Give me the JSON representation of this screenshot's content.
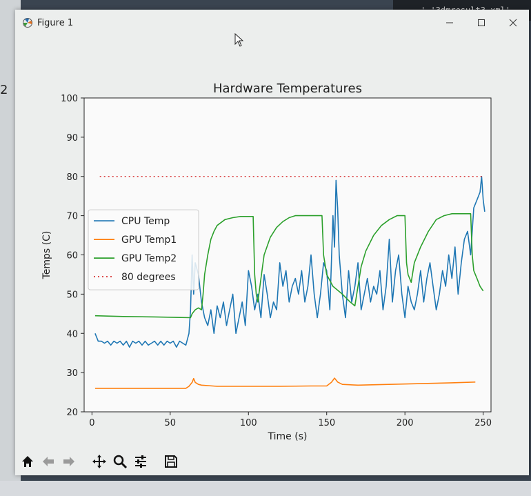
{
  "window": {
    "title": "Figure 1"
  },
  "background": {
    "left_text": "2",
    "code_snippet": "' '3dmresult3.xml'"
  },
  "toolbar": {
    "buttons": [
      "home-icon",
      "back-icon",
      "forward-icon",
      "pan-icon",
      "zoom-icon",
      "configure-icon",
      "save-icon"
    ]
  },
  "chart_data": {
    "type": "line",
    "title": "Hardware Temperatures",
    "xlabel": "Time (s)",
    "ylabel": "Temps (C)",
    "xlim": [
      -5,
      255
    ],
    "ylim": [
      20,
      100
    ],
    "xticks": [
      0,
      50,
      100,
      150,
      200,
      250
    ],
    "yticks": [
      20,
      30,
      40,
      50,
      60,
      70,
      80,
      90,
      100
    ],
    "grid": false,
    "legend_position": "center-left",
    "series": [
      {
        "name": "CPU Temp",
        "color": "#1f77b4",
        "x": [
          2,
          4,
          6,
          8,
          10,
          12,
          14,
          16,
          18,
          20,
          22,
          24,
          26,
          28,
          30,
          32,
          34,
          36,
          38,
          40,
          42,
          44,
          46,
          48,
          50,
          52,
          54,
          56,
          58,
          60,
          62,
          63,
          64,
          65,
          66,
          68,
          70,
          72,
          74,
          76,
          78,
          80,
          82,
          84,
          86,
          88,
          90,
          92,
          94,
          96,
          98,
          100,
          102,
          104,
          106,
          108,
          110,
          112,
          114,
          116,
          118,
          120,
          122,
          124,
          126,
          128,
          130,
          132,
          134,
          136,
          138,
          140,
          142,
          144,
          146,
          148,
          150,
          152,
          154,
          155,
          156,
          157,
          158,
          160,
          162,
          164,
          166,
          168,
          170,
          172,
          174,
          176,
          178,
          180,
          182,
          184,
          186,
          188,
          190,
          192,
          194,
          196,
          198,
          200,
          202,
          204,
          206,
          208,
          210,
          212,
          214,
          216,
          218,
          220,
          222,
          224,
          226,
          228,
          230,
          232,
          234,
          236,
          238,
          240,
          242,
          244,
          246,
          248,
          249,
          250,
          251
        ],
        "y": [
          40,
          38,
          38,
          37.5,
          38,
          37,
          38,
          37.5,
          38,
          37,
          38,
          36.5,
          38,
          37.5,
          38,
          37,
          38,
          37,
          37.5,
          38,
          37,
          38,
          37,
          38,
          37.5,
          38,
          36.5,
          38,
          37.5,
          37,
          40,
          46,
          60,
          50,
          58,
          55,
          48,
          44,
          42,
          46,
          40,
          47,
          44,
          48,
          42,
          46,
          50,
          40,
          44,
          48,
          42,
          56,
          52,
          46,
          50,
          44,
          55,
          50,
          44,
          48,
          46,
          58,
          52,
          56,
          48,
          52,
          54,
          50,
          56,
          48,
          52,
          60,
          50,
          44,
          50,
          58,
          56,
          46,
          70,
          62,
          79,
          72,
          60,
          50,
          44,
          56,
          48,
          52,
          58,
          46,
          50,
          54,
          48,
          52,
          50,
          56,
          46,
          52,
          64,
          48,
          56,
          60,
          50,
          44,
          52,
          48,
          46,
          50,
          56,
          48,
          54,
          58,
          52,
          46,
          50,
          56,
          52,
          60,
          54,
          62,
          50,
          58,
          64,
          66,
          60,
          72,
          74,
          76,
          80,
          74,
          71
        ],
        "stroke_width": 1.6
      },
      {
        "name": "GPU Temp1",
        "color": "#ff7f0e",
        "x": [
          2,
          20,
          40,
          60,
          62,
          64,
          65,
          66,
          68,
          70,
          80,
          100,
          120,
          140,
          150,
          153,
          155,
          157,
          160,
          170,
          190,
          210,
          230,
          245
        ],
        "y": [
          26,
          26,
          26,
          26,
          26.5,
          27.5,
          28.5,
          27.5,
          27,
          26.8,
          26.5,
          26.5,
          26.5,
          26.6,
          26.6,
          27.5,
          28.6,
          27.6,
          27,
          26.8,
          27,
          27.2,
          27.4,
          27.6
        ],
        "stroke_width": 1.6
      },
      {
        "name": "GPU Temp2",
        "color": "#2ca02c",
        "x": [
          2,
          20,
          40,
          63,
          64,
          66,
          68,
          70,
          71,
          72,
          74,
          76,
          78,
          80,
          85,
          90,
          95,
          100,
          103,
          104,
          105,
          106,
          108,
          110,
          114,
          118,
          122,
          126,
          130,
          140,
          145,
          147,
          148,
          150,
          154,
          160,
          165,
          168,
          170,
          172,
          175,
          180,
          185,
          190,
          195,
          198,
          200,
          201,
          202,
          204,
          206,
          210,
          215,
          220,
          225,
          230,
          240,
          242,
          243,
          244,
          246,
          248,
          250
        ],
        "y": [
          44.5,
          44.3,
          44.2,
          44,
          45,
          46,
          46.5,
          46,
          50,
          55,
          60,
          64,
          66,
          67.5,
          69,
          69.5,
          69.8,
          69.8,
          69.8,
          55,
          50,
          48,
          54,
          60,
          64.5,
          67,
          68.5,
          69.5,
          70,
          70,
          70,
          70,
          60,
          55,
          52,
          50,
          48,
          47,
          52,
          57,
          61,
          65,
          67.5,
          69,
          70,
          70,
          70,
          58,
          55,
          53,
          58,
          62,
          66,
          69,
          70,
          70.5,
          70.5,
          70.5,
          60,
          56,
          54,
          52,
          50.8
        ],
        "stroke_width": 1.6
      },
      {
        "name": "80 degrees",
        "color": "#d62728",
        "linestyle": "dotted",
        "x": [
          5,
          250
        ],
        "y": [
          80,
          80
        ],
        "stroke_width": 1.4
      }
    ]
  }
}
